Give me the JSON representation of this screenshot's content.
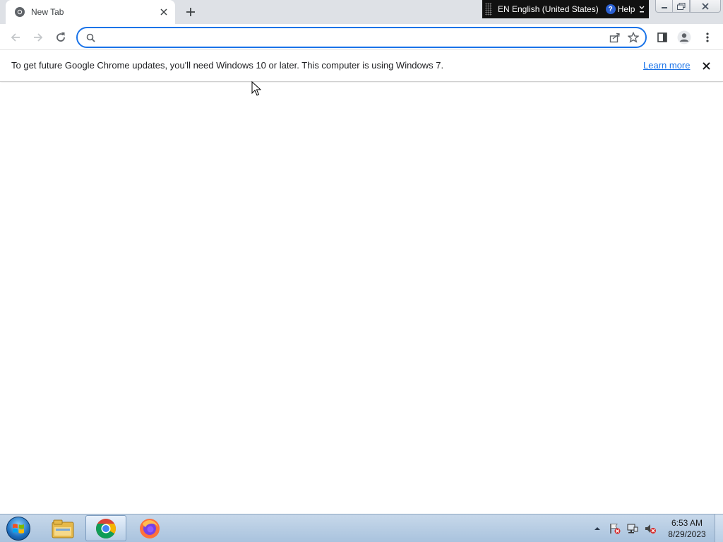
{
  "browser": {
    "tab": {
      "title": "New Tab",
      "favicon": "chrome-icon"
    },
    "omnibox": {
      "value": "",
      "placeholder": ""
    },
    "toolbar_icons": [
      "back-arrow-icon",
      "forward-arrow-icon",
      "reload-icon",
      "share-icon",
      "star-icon",
      "side-panel-icon",
      "profile-icon",
      "kebab-menu-icon"
    ]
  },
  "infobar": {
    "message": "To get future Google Chrome updates, you'll need Windows 10 or later. This computer is using Windows 7.",
    "link": "Learn more"
  },
  "language_bar": {
    "language": "EN English (United States)",
    "help": "Help",
    "help_icon_glyph": "?"
  },
  "taskbar": {
    "apps": [
      "windows-explorer",
      "google-chrome",
      "firefox"
    ],
    "active_app": "google-chrome",
    "clock": {
      "time": "6:53 AM",
      "date": "8/29/2023"
    }
  },
  "colors": {
    "accent": "#1a73e8",
    "tabstrip": "#dee1e6",
    "taskbar": "#b6cde6"
  }
}
